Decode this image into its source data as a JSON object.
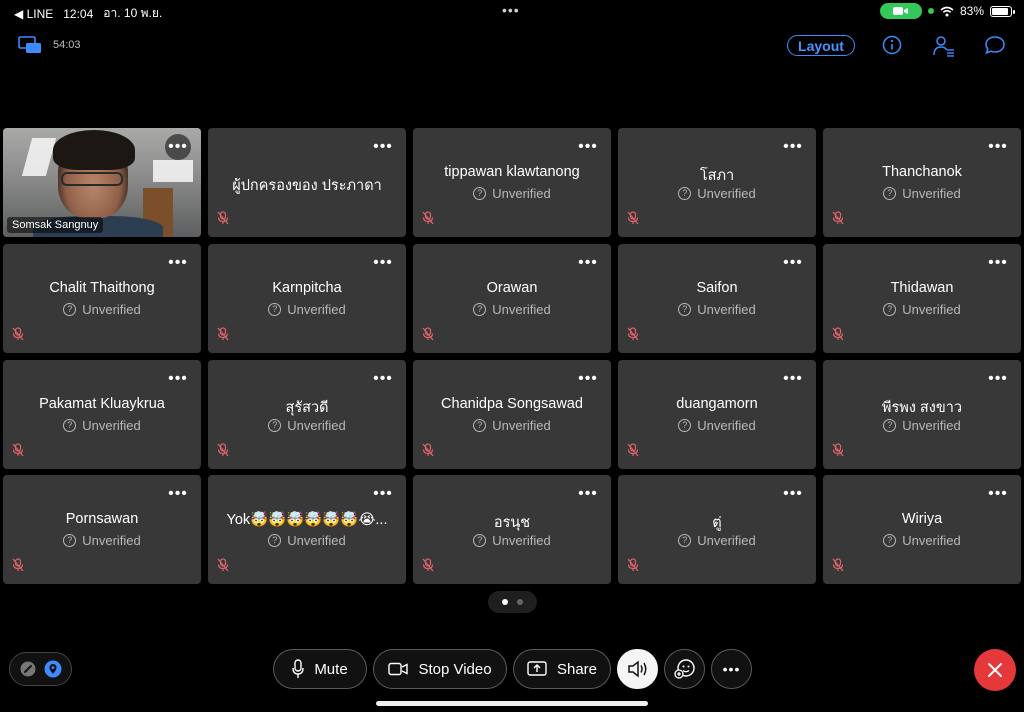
{
  "status_bar": {
    "back_app": "◀ LINE",
    "time": "12:04",
    "date": "อา. 10 พ.ย.",
    "battery": "83%",
    "battery_level": 0.83,
    "colors": {
      "camera_indicator": "#34c759"
    }
  },
  "header": {
    "timer": "54:03",
    "layout_label": "Layout",
    "colors": {
      "accent": "#3d8bff"
    }
  },
  "self_view": {
    "name": "Somsak Sangnuy"
  },
  "participants": [
    {
      "name": "ผู้ปกครองของ ประภาดา",
      "status": ""
    },
    {
      "name": "tippawan klawtanong",
      "status": "Unverified"
    },
    {
      "name": "โสภา",
      "status": "Unverified"
    },
    {
      "name": "Thanchanok",
      "status": "Unverified"
    },
    {
      "name": "Chalit Thaithong",
      "status": "Unverified"
    },
    {
      "name": "Karnpitcha",
      "status": "Unverified"
    },
    {
      "name": "Orawan",
      "status": "Unverified"
    },
    {
      "name": "Saifon",
      "status": "Unverified"
    },
    {
      "name": "Thidawan",
      "status": "Unverified"
    },
    {
      "name": "Pakamat Kluaykrua",
      "status": "Unverified"
    },
    {
      "name": "สุรัสวดี",
      "status": "Unverified"
    },
    {
      "name": "Chanidpa Songsawad",
      "status": "Unverified"
    },
    {
      "name": "duangamorn",
      "status": "Unverified"
    },
    {
      "name": "พีรพง สงขาว",
      "status": "Unverified"
    },
    {
      "name": "Pornsawan",
      "status": "Unverified"
    },
    {
      "name": "Yok🤯🤯🤯🤯🤯🤯😭...",
      "status": "Unverified"
    },
    {
      "name": "อรนุช",
      "status": "Unverified"
    },
    {
      "name": "ตู่",
      "status": "Unverified"
    },
    {
      "name": "Wiriya",
      "status": "Unverified"
    }
  ],
  "pager": {
    "pages": 2,
    "current": 1
  },
  "controls": {
    "mute_label": "Mute",
    "video_label": "Stop Video",
    "share_label": "Share",
    "colors": {
      "end_call": "#e5383b"
    }
  },
  "icons": {
    "more": "•••"
  }
}
